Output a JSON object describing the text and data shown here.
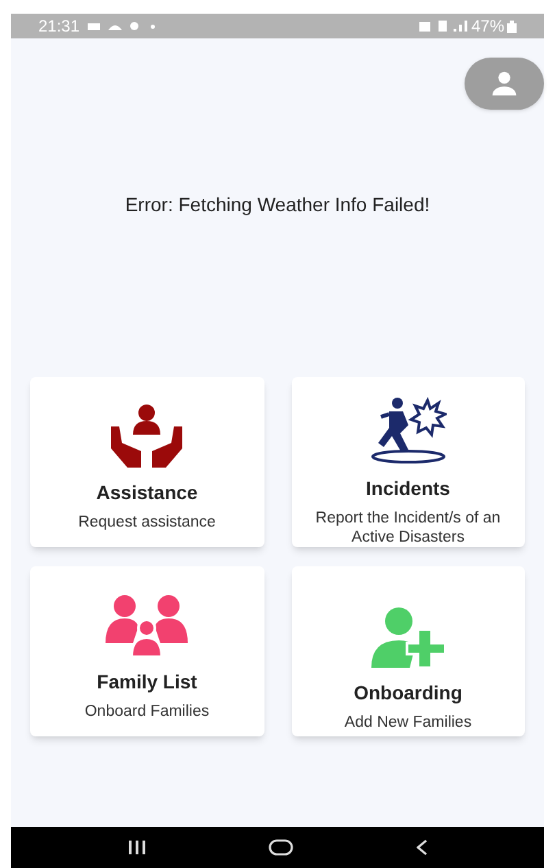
{
  "status_bar": {
    "time": "21:31",
    "battery": "47%"
  },
  "message": "Error: Fetching Weather Info Failed!",
  "cards": [
    {
      "kind": "assistance",
      "title": "Assistance",
      "subtitle": "Request assistance"
    },
    {
      "kind": "incidents",
      "title": "Incidents",
      "subtitle": "Report the Incident/s of an Active Disasters"
    },
    {
      "kind": "family",
      "title": "Family List",
      "subtitle": "Onboard Families"
    },
    {
      "kind": "onboarding",
      "title": "Onboarding",
      "subtitle": "Add New Families"
    }
  ]
}
